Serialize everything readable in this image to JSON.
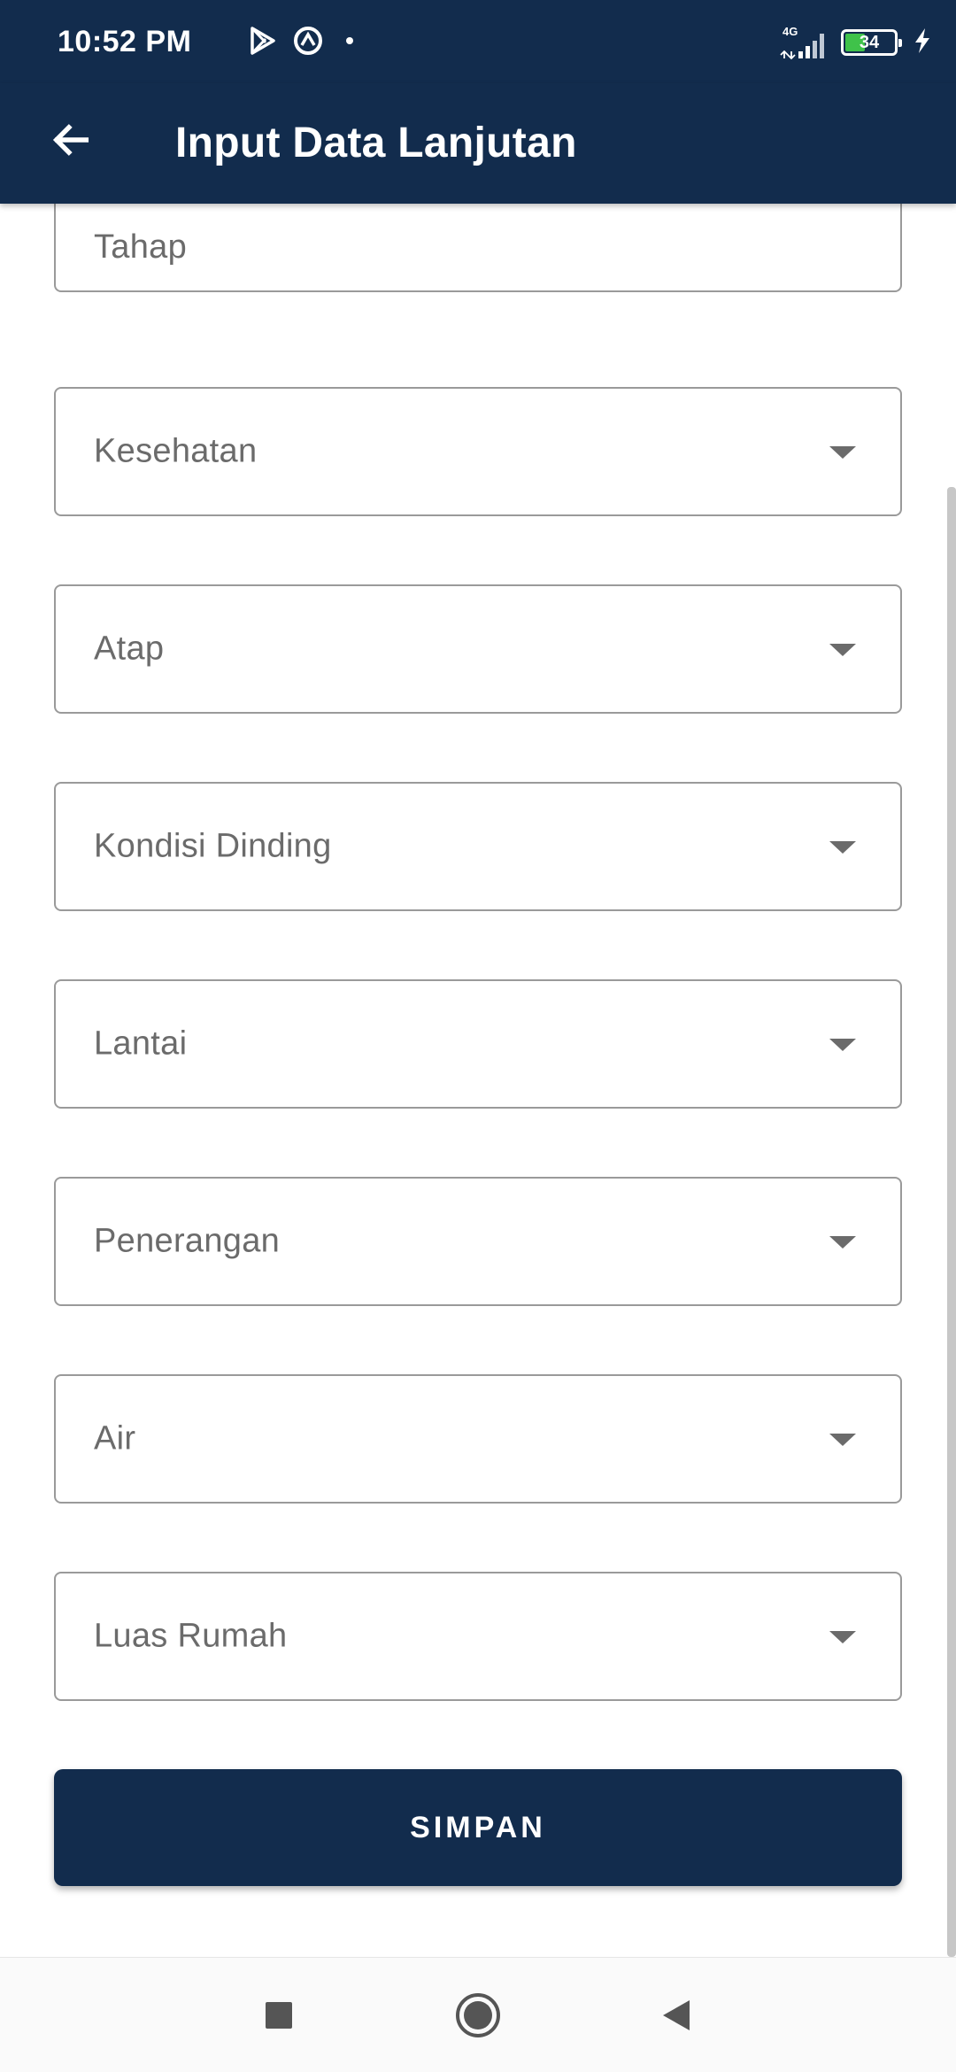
{
  "status_bar": {
    "time": "10:52 PM",
    "network": "4G",
    "battery": "34",
    "icons_left": [
      "play-store-icon",
      "sync-icon",
      "dot-icon"
    ],
    "icons_right": [
      "signal-icon",
      "battery-icon",
      "charging-icon"
    ]
  },
  "app_bar": {
    "title": "Input Data Lanjutan",
    "back_icon": "arrow-back-icon",
    "color": "#122c4d"
  },
  "form": {
    "fields": [
      {
        "label": "Tahap",
        "type": "text"
      },
      {
        "label": "Kesehatan",
        "type": "dropdown"
      },
      {
        "label": "Atap",
        "type": "dropdown"
      },
      {
        "label": "Kondisi Dinding",
        "type": "dropdown"
      },
      {
        "label": "Lantai",
        "type": "dropdown"
      },
      {
        "label": "Penerangan",
        "type": "dropdown"
      },
      {
        "label": "Air",
        "type": "dropdown"
      },
      {
        "label": "Luas Rumah",
        "type": "dropdown"
      }
    ],
    "submit_label": "SIMPAN"
  },
  "nav_bar": {
    "buttons": [
      "recents-icon",
      "home-icon",
      "back-icon"
    ]
  }
}
